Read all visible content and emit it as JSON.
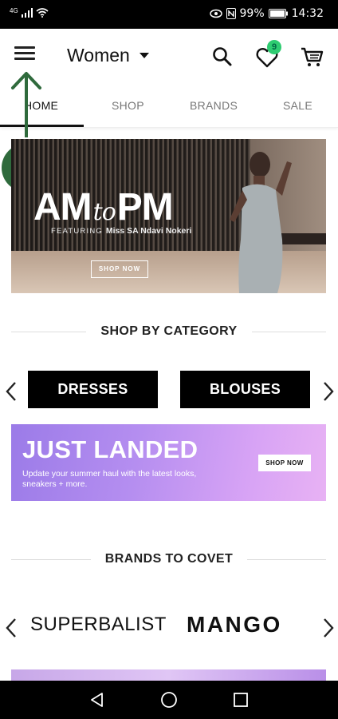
{
  "status_bar": {
    "network": "4G",
    "battery": "99%",
    "time": "14:32"
  },
  "app_bar": {
    "section": "Women",
    "wishlist_count": "9"
  },
  "tabs": [
    {
      "label": "HOME",
      "active": true
    },
    {
      "label": "SHOP",
      "active": false
    },
    {
      "label": "BRANDS",
      "active": false
    },
    {
      "label": "SALE",
      "active": false
    }
  ],
  "annotation": {
    "step": "1",
    "color": "#2f6a3c"
  },
  "hero": {
    "title_big1": "AM",
    "title_small": "to",
    "title_big2": "PM",
    "featuring_label": "FEATURING",
    "featuring_name": "Miss SA Ndavi Nokeri",
    "button": "SHOP NOW"
  },
  "category_section": {
    "heading": "SHOP BY CATEGORY",
    "items": [
      "DRESSES",
      "BLOUSES"
    ]
  },
  "just_landed": {
    "title": "JUST LANDED",
    "description": "Update your summer haul with the latest looks, sneakers + more.",
    "button": "SHOP NOW"
  },
  "brands_section": {
    "heading": "BRANDS TO COVET",
    "brands": [
      "SUPERBALIST",
      "MANGO"
    ]
  },
  "icons": {
    "menu": "hamburger-menu-icon",
    "search": "search-icon",
    "wishlist": "heart-icon",
    "cart": "cart-icon",
    "back": "back-triangle-icon",
    "home": "home-circle-icon",
    "recents": "recents-square-icon"
  },
  "colors": {
    "accent": "#000000",
    "badge": "#2ecc71",
    "annotation": "#2f6a3c"
  }
}
